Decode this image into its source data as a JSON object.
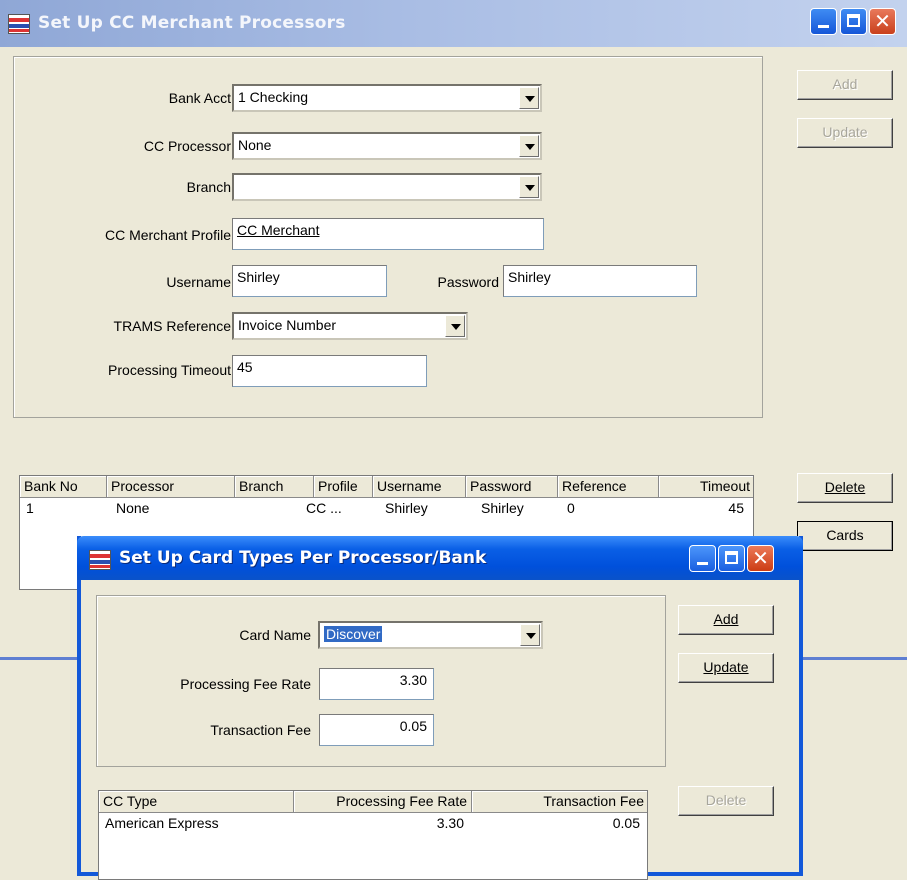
{
  "main_window": {
    "title": "Set Up CC Merchant Processors",
    "buttons": {
      "add": "Add",
      "update": "Update",
      "delete": "Delete",
      "cards": "Cards"
    },
    "form": {
      "bank_acct_label": "Bank Acct",
      "bank_acct_value": "1 Checking",
      "cc_processor_label": "CC Processor",
      "cc_processor_value": "None",
      "branch_label": "Branch",
      "branch_value": "",
      "merchant_profile_label": "CC Merchant Profile",
      "merchant_profile_value": "CC Merchant",
      "username_label": "Username",
      "username_value": "Shirley",
      "password_label": "Password",
      "password_value": "Shirley",
      "trams_reference_label": "TRAMS Reference",
      "trams_reference_value": "Invoice Number",
      "processing_timeout_label": "Processing Timeout",
      "processing_timeout_value": "45"
    },
    "table": {
      "headers": [
        "Bank No",
        "Processor",
        "Branch",
        "Profile",
        "Username",
        "Password",
        "Reference",
        "Timeout"
      ],
      "rows": [
        [
          "1",
          "None",
          "",
          "CC ...",
          "Shirley",
          "Shirley",
          "0",
          "45"
        ]
      ]
    }
  },
  "child_window": {
    "title": "Set Up Card Types Per Processor/Bank",
    "buttons": {
      "add": "Add",
      "update": "Update",
      "delete": "Delete"
    },
    "form": {
      "card_name_label": "Card Name",
      "card_name_value": "Discover",
      "fee_rate_label": "Processing Fee Rate",
      "fee_rate_value": "3.30",
      "transaction_fee_label": "Transaction Fee",
      "transaction_fee_value": "0.05"
    },
    "table": {
      "headers": [
        "CC Type",
        "Processing Fee Rate",
        "Transaction Fee"
      ],
      "rows": [
        [
          "American Express",
          "3.30",
          "0.05"
        ]
      ]
    }
  },
  "colors": {
    "xp_title_blue": "#0050db",
    "selection_blue": "#316ac5",
    "disabled_text": "#a8a69c"
  }
}
